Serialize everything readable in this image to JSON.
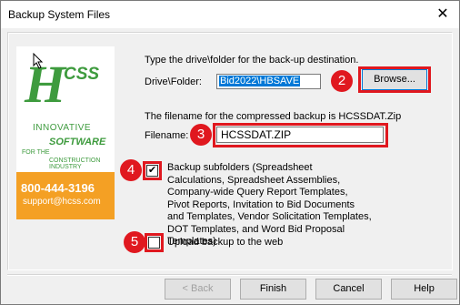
{
  "window": {
    "title": "Backup System Files",
    "close_glyph": "✕"
  },
  "logo": {
    "letter": "H",
    "css": "CSS",
    "innovative": "INNOVATIVE",
    "software": "SOFTWARE",
    "for_the": "FOR THE",
    "industry": "CONSTRUCTION INDUSTRY",
    "phone": "800-444-3196",
    "email": "support@hcss.com"
  },
  "drive": {
    "instruction": "Type the drive\\folder for the back-up destination.",
    "label": "Drive\\Folder:",
    "value": "Bid2022\\HBSAVE",
    "browse_label": "Browse..."
  },
  "filename": {
    "info": "The filename for the compressed backup is HCSSDAT.Zip",
    "label": "Filename:",
    "value": "HCSSDAT.ZIP"
  },
  "backup_subfolders": {
    "checked": true,
    "label": "Backup subfolders (Spreadsheet Calculations, Spreadsheet Assemblies, Company-wide Query Report Templates, Pivot Reports, Invitation to Bid Documents and Templates, Vendor Solicitation Templates, DOT Templates, and Word Bid Proposal Templates)"
  },
  "upload": {
    "checked": false,
    "label": "Upload backup to the web"
  },
  "annotations": {
    "n2": "2",
    "n3": "3",
    "n4": "4",
    "n5": "5",
    "color": "#e0181f"
  },
  "buttons": {
    "back": "< Back",
    "finish": "Finish",
    "cancel": "Cancel",
    "help": "Help"
  }
}
